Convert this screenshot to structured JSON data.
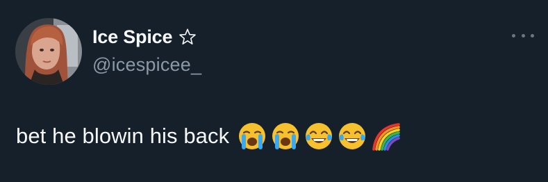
{
  "author": {
    "display_name": "Ice Spice",
    "handle": "@icespicee_",
    "badge_icon": "star-outline-icon"
  },
  "tweet": {
    "text": "bet he blowin his back",
    "emojis": [
      "loudly-crying-face-icon",
      "loudly-crying-face-icon",
      "face-with-tears-of-joy-icon",
      "face-with-tears-of-joy-icon",
      "rainbow-icon"
    ]
  },
  "menu": {
    "icon": "more-horizontal-icon"
  },
  "colors": {
    "background": "#15202b",
    "primary_text": "#f7f9f9",
    "secondary_text": "#8b98a5"
  }
}
